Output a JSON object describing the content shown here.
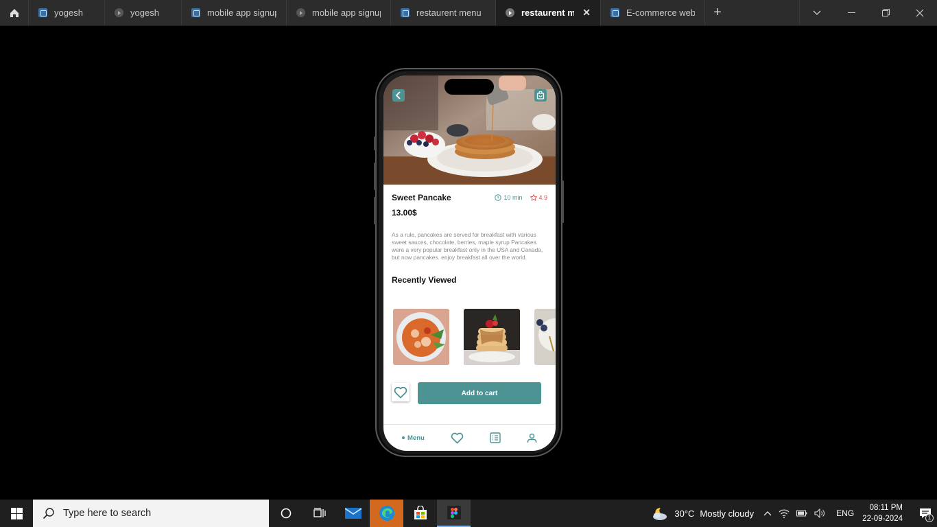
{
  "browser": {
    "tabs": [
      {
        "label": "yogesh",
        "icon": "figma-file-icon",
        "active": false
      },
      {
        "label": "yogesh",
        "icon": "prototype-play-icon",
        "active": false
      },
      {
        "label": "mobile app signup",
        "icon": "figma-file-icon",
        "active": false
      },
      {
        "label": "mobile app signup",
        "icon": "prototype-play-icon",
        "active": false
      },
      {
        "label": "restaurent menu",
        "icon": "figma-file-icon",
        "active": false
      },
      {
        "label": "restaurent menu",
        "icon": "prototype-play-icon",
        "active": true
      },
      {
        "label": "E-commerce webs",
        "icon": "figma-file-icon",
        "active": false
      }
    ],
    "new_tab": "+",
    "close_tab": "✕"
  },
  "app": {
    "dish_name": "Sweet Pancake",
    "time": "10 min",
    "rating": "4.9",
    "price": "13.00$",
    "description": "As a rule, pancakes are served for breakfast with various sweet sauces, chocolate, berries, maple syrup Pancakes were a very popular breakfast only in the USA and Canada, but now pancakes. enjoy breakfast all over the world.",
    "recently_viewed_title": "Recently Viewed",
    "add_to_cart": "Add to cart",
    "nav": {
      "menu_label": "Menu"
    },
    "accent_color": "#4e9393",
    "rating_color": "#d9534f"
  },
  "taskbar": {
    "search_placeholder": "Type here to search",
    "weather_temp": "30°C",
    "weather_desc": "Mostly cloudy",
    "language": "ENG",
    "time": "08:11 PM",
    "date": "22-09-2024",
    "notification_count": "1"
  }
}
